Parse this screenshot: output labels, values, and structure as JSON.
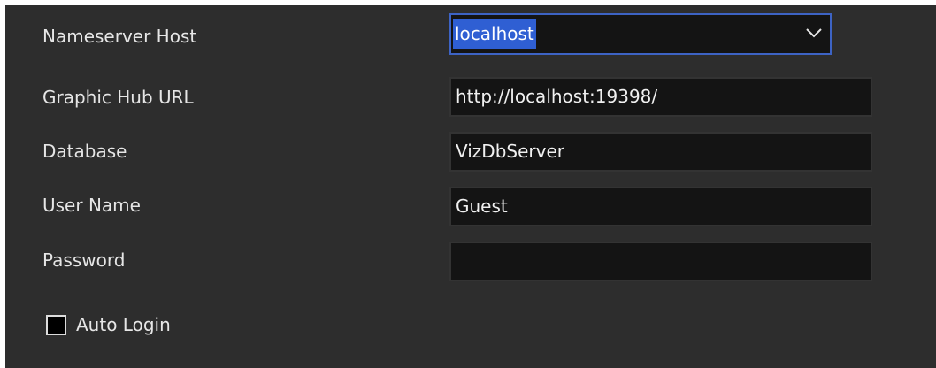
{
  "form": {
    "nameserver_host": {
      "label": "Nameserver Host",
      "value": "localhost",
      "icon": "chevron-down-icon"
    },
    "graphic_hub_url": {
      "label": "Graphic Hub URL",
      "value": "http://localhost:19398/"
    },
    "database": {
      "label": "Database",
      "value": "VizDbServer"
    },
    "user_name": {
      "label": "User Name",
      "value": "Guest"
    },
    "password": {
      "label": "Password",
      "value": ""
    },
    "auto_login": {
      "label": "Auto Login",
      "checked": false
    }
  },
  "colors": {
    "panel_background": "#2d2d2d",
    "field_background": "#141414",
    "focus_border": "#3d63c4",
    "selection": "#2f5fd3",
    "text": "#e6e6e6"
  }
}
